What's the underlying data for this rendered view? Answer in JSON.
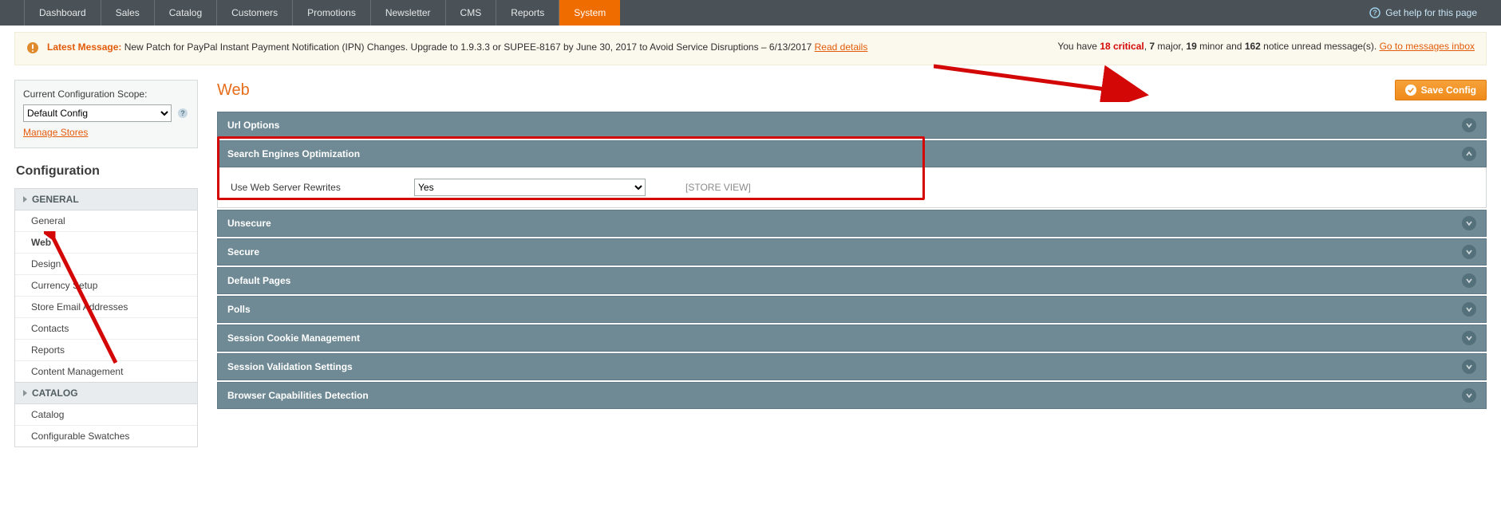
{
  "topnav": {
    "items": [
      {
        "label": "Dashboard"
      },
      {
        "label": "Sales"
      },
      {
        "label": "Catalog"
      },
      {
        "label": "Customers"
      },
      {
        "label": "Promotions"
      },
      {
        "label": "Newsletter"
      },
      {
        "label": "CMS"
      },
      {
        "label": "Reports"
      },
      {
        "label": "System"
      }
    ],
    "active_index": 8,
    "help_label": "Get help for this page"
  },
  "notice": {
    "latest_label": "Latest Message:",
    "message_text": " New Patch for PayPal Instant Payment Notification (IPN) Changes. Upgrade to 1.9.3.3 or SUPEE-8167 by June 30, 2017 to Avoid Service Disruptions – 6/13/2017 ",
    "read_details": "Read details",
    "status_prefix": "You have ",
    "critical_count": "18",
    "critical_label": " critical",
    "sep": ", ",
    "major_count": "7",
    "major_label": " major, ",
    "minor_count": "19",
    "minor_label": " minor and ",
    "notice_count": "162",
    "notice_label": " notice unread message(s). ",
    "inbox_link": "Go to messages inbox"
  },
  "sidebar": {
    "scope_label": "Current Configuration Scope:",
    "scope_value": "Default Config",
    "manage_stores": "Manage Stores",
    "config_title": "Configuration",
    "sections": [
      {
        "title": "GENERAL",
        "items": [
          {
            "label": "General"
          },
          {
            "label": "Web"
          },
          {
            "label": "Design"
          },
          {
            "label": "Currency Setup"
          },
          {
            "label": "Store Email Addresses"
          },
          {
            "label": "Contacts"
          },
          {
            "label": "Reports"
          },
          {
            "label": "Content Management"
          }
        ],
        "active_index": 1
      },
      {
        "title": "CATALOG",
        "items": [
          {
            "label": "Catalog"
          },
          {
            "label": "Configurable Swatches"
          }
        ],
        "active_index": -1
      }
    ]
  },
  "main": {
    "title": "Web",
    "save_label": "Save Config",
    "panels": [
      {
        "title": "Url Options",
        "expanded": false
      },
      {
        "title": "Search Engines Optimization",
        "expanded": true,
        "field_label": "Use Web Server Rewrites",
        "field_value": "Yes",
        "field_scope": "[STORE VIEW]"
      },
      {
        "title": "Unsecure",
        "expanded": false
      },
      {
        "title": "Secure",
        "expanded": false
      },
      {
        "title": "Default Pages",
        "expanded": false
      },
      {
        "title": "Polls",
        "expanded": false
      },
      {
        "title": "Session Cookie Management",
        "expanded": false
      },
      {
        "title": "Session Validation Settings",
        "expanded": false
      },
      {
        "title": "Browser Capabilities Detection",
        "expanded": false
      }
    ]
  }
}
